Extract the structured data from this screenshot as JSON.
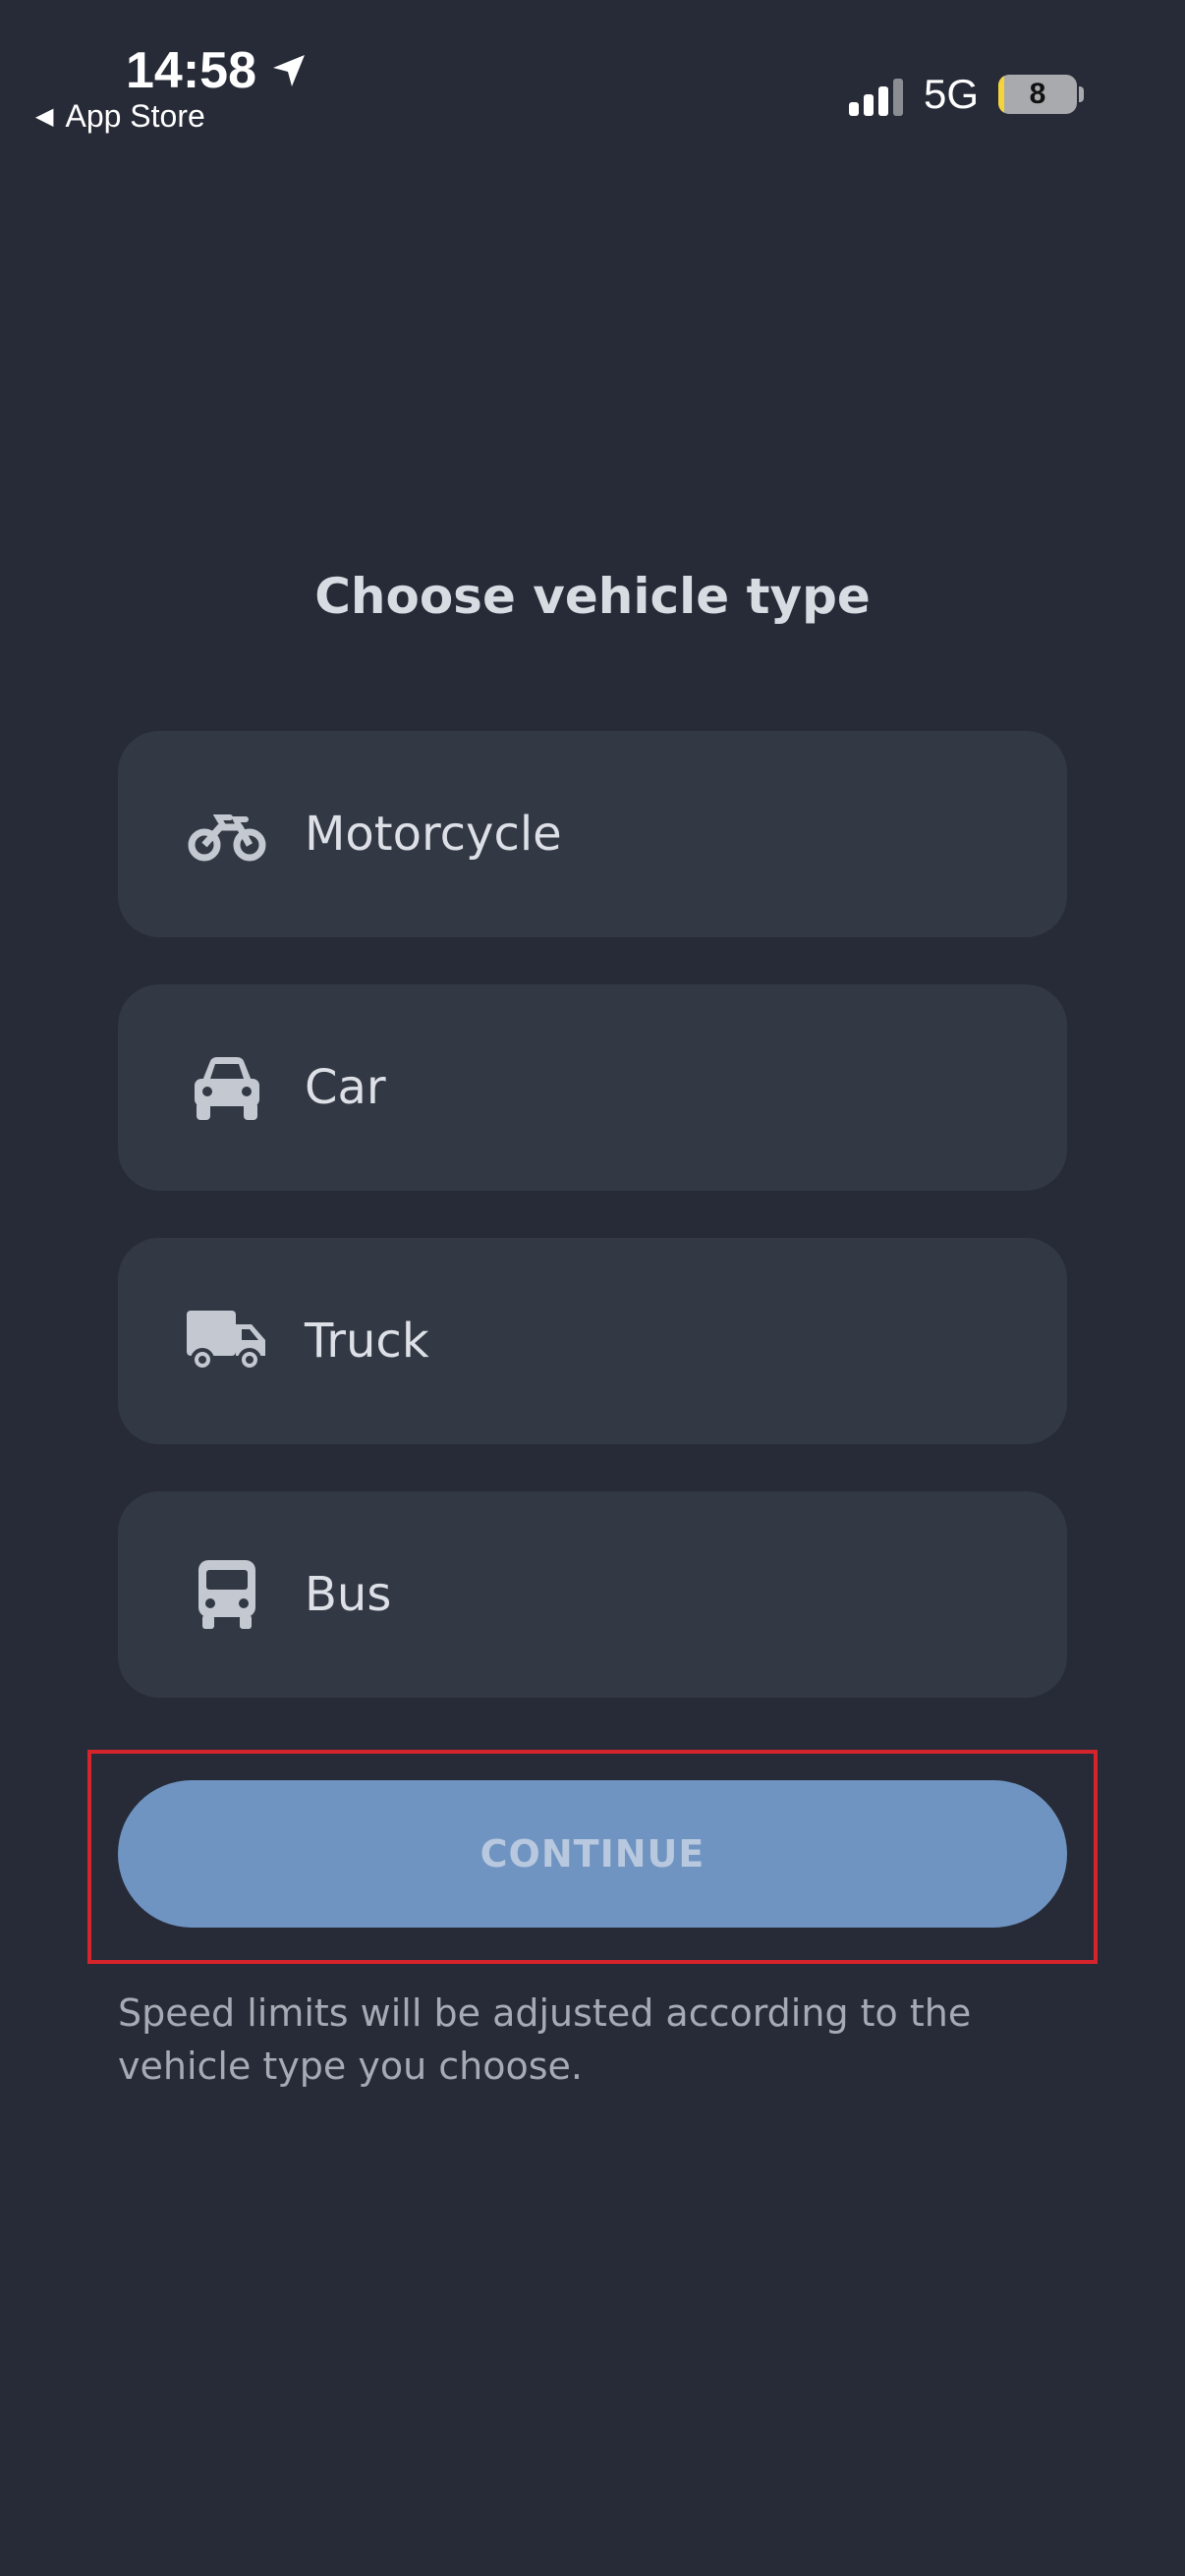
{
  "status_bar": {
    "time": "14:58",
    "back_label": "App Store",
    "network": "5G",
    "battery_level": "8"
  },
  "screen": {
    "title": "Choose vehicle type",
    "options": [
      {
        "label": "Motorcycle",
        "icon": "motorcycle-icon"
      },
      {
        "label": "Car",
        "icon": "car-icon"
      },
      {
        "label": "Truck",
        "icon": "truck-icon"
      },
      {
        "label": "Bus",
        "icon": "bus-icon"
      }
    ],
    "continue_label": "CONTINUE",
    "note": "Speed limits will be adjusted according to the vehicle type you choose."
  },
  "colors": {
    "background": "#272b37",
    "card": "#333845",
    "button": "#6f94c2",
    "highlight": "#d6242c",
    "battery_fill": "#f5d33a"
  }
}
